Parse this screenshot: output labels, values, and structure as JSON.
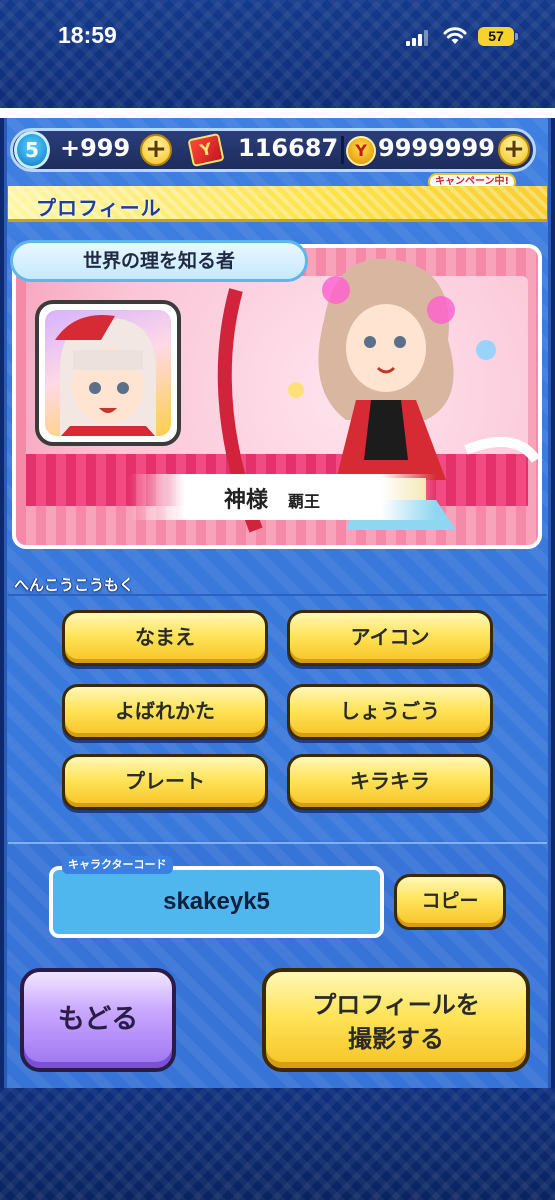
{
  "status_bar": {
    "time": "18:59",
    "battery": "57"
  },
  "currency": {
    "level_badge": "5",
    "stamina": "+999",
    "tickets": "116687",
    "coins": "9999999",
    "campaign_tag": "キャンペーン中!"
  },
  "profile": {
    "header_title": "プロフィール",
    "title_text": "世界の理を知る者",
    "name": "神様",
    "rank": "覇王"
  },
  "edit_section": {
    "label": "へんこうこうもく",
    "buttons": [
      "なまえ",
      "アイコン",
      "よばれかた",
      "しょうごう",
      "プレート",
      "キラキラ"
    ]
  },
  "character_code": {
    "label": "キャラクターコード",
    "value": "skakeyk5",
    "copy_label": "コピー"
  },
  "actions": {
    "back_label": "もどる",
    "photo_label_line1": "プロフィールを",
    "photo_label_line2": "撮影する"
  },
  "colors": {
    "panel_blue": "#3f7fe0",
    "button_yellow": "#ffe45a",
    "back_purple": "#c9a8ff",
    "card_pink": "#f48aa8"
  }
}
